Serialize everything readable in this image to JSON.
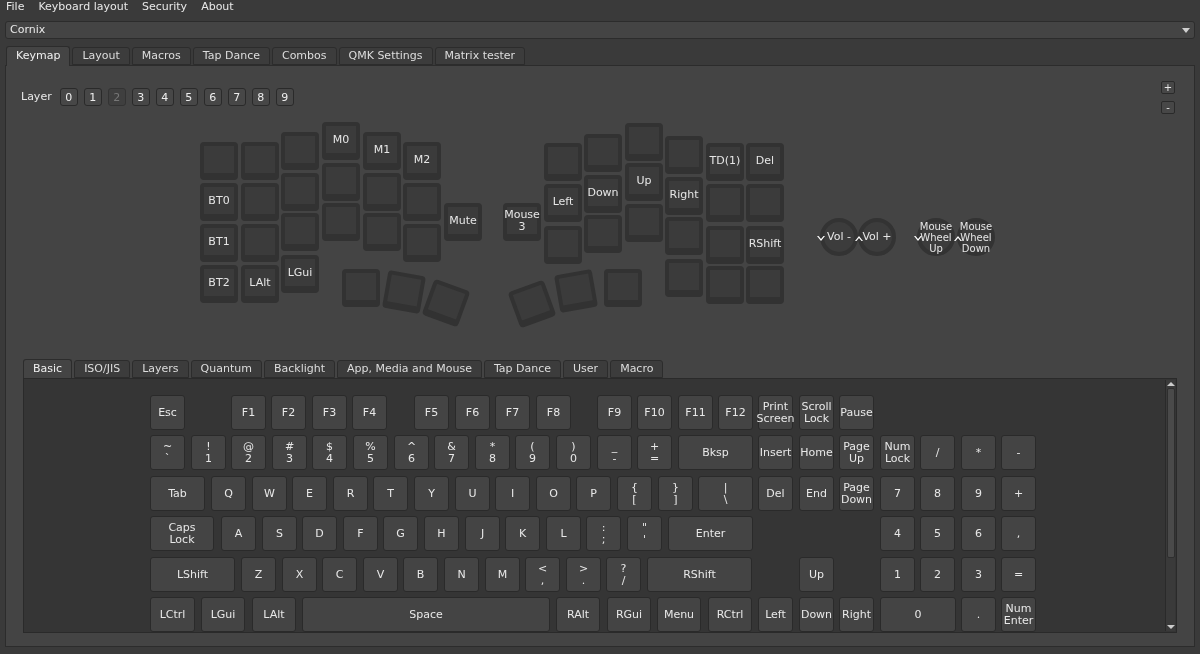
{
  "menu": [
    "File",
    "Keyboard layout",
    "Security",
    "About"
  ],
  "keyboard_select": {
    "value": "Cornix"
  },
  "tabs": [
    {
      "label": "Keymap",
      "selected": true
    },
    {
      "label": "Layout",
      "selected": false
    },
    {
      "label": "Macros",
      "selected": false
    },
    {
      "label": "Tap Dance",
      "selected": false
    },
    {
      "label": "Combos",
      "selected": false
    },
    {
      "label": "QMK Settings",
      "selected": false
    },
    {
      "label": "Matrix tester",
      "selected": false
    }
  ],
  "layers": {
    "label": "Layer",
    "buttons": [
      {
        "label": "0",
        "selected": false
      },
      {
        "label": "1",
        "selected": false
      },
      {
        "label": "2",
        "selected": true
      },
      {
        "label": "3",
        "selected": false
      },
      {
        "label": "4",
        "selected": false
      },
      {
        "label": "5",
        "selected": false
      },
      {
        "label": "6",
        "selected": false
      },
      {
        "label": "7",
        "selected": false
      },
      {
        "label": "8",
        "selected": false
      },
      {
        "label": "9",
        "selected": false
      }
    ]
  },
  "layer_controls": [
    "+",
    "-"
  ],
  "keymap": {
    "left": [
      {
        "kind": "blank"
      },
      {
        "kind": "labeled",
        "label": "BT0"
      },
      {
        "kind": "labeled",
        "label": "BT1"
      },
      {
        "kind": "labeled",
        "label": "BT2"
      },
      {
        "kind": "blank"
      },
      {
        "kind": "blank"
      },
      {
        "kind": "blank"
      },
      {
        "kind": "labeled",
        "label": "LAlt"
      },
      {
        "kind": "blank"
      },
      {
        "kind": "blank"
      },
      {
        "kind": "blank"
      },
      {
        "kind": "labeled",
        "label": "LGui"
      },
      {
        "kind": "labeled",
        "label": "M0"
      },
      {
        "kind": "blank"
      },
      {
        "kind": "blank"
      },
      {
        "kind": "labeled",
        "label": "M1"
      },
      {
        "kind": "blank"
      },
      {
        "kind": "blank"
      },
      {
        "kind": "labeled",
        "label": "M2"
      },
      {
        "kind": "blank"
      },
      {
        "kind": "blank"
      },
      {
        "kind": "labeled",
        "label": "Mute"
      },
      {
        "kind": "blank"
      },
      {
        "kind": "blank"
      },
      {
        "kind": "blank"
      }
    ],
    "right": [
      {
        "kind": "labeled",
        "label": "Mouse\n3"
      },
      {
        "kind": "blank"
      },
      {
        "kind": "labeled",
        "label": "Left"
      },
      {
        "kind": "blank"
      },
      {
        "kind": "blank"
      },
      {
        "kind": "labeled",
        "label": "Down"
      },
      {
        "kind": "blank"
      },
      {
        "kind": "blank"
      },
      {
        "kind": "labeled",
        "label": "Up"
      },
      {
        "kind": "blank"
      },
      {
        "kind": "blank"
      },
      {
        "kind": "labeled",
        "label": "Right"
      },
      {
        "kind": "blank"
      },
      {
        "kind": "blank"
      },
      {
        "kind": "labeled",
        "label": "TD(1)"
      },
      {
        "kind": "blank"
      },
      {
        "kind": "blank"
      },
      {
        "kind": "blank"
      },
      {
        "kind": "labeled",
        "label": "Del"
      },
      {
        "kind": "blank"
      },
      {
        "kind": "labeled",
        "label": "RShift"
      },
      {
        "kind": "blank"
      },
      {
        "kind": "blank"
      },
      {
        "kind": "blank"
      },
      {
        "kind": "blank"
      }
    ],
    "encoders": [
      {
        "kind": "down",
        "label": "Vol -"
      },
      {
        "kind": "up",
        "label": "Vol +"
      },
      {
        "kind": "down",
        "label": "Mouse\nWheel\nUp"
      },
      {
        "kind": "up",
        "label": "Mouse\nWheel\nDown"
      }
    ]
  },
  "keycode_tabs": [
    {
      "label": "Basic",
      "selected": true
    },
    {
      "label": "ISO/JIS",
      "selected": false
    },
    {
      "label": "Layers",
      "selected": false
    },
    {
      "label": "Quantum",
      "selected": false
    },
    {
      "label": "Backlight",
      "selected": false
    },
    {
      "label": "App, Media and Mouse",
      "selected": false
    },
    {
      "label": "Tap Dance",
      "selected": false
    },
    {
      "label": "User",
      "selected": false
    },
    {
      "label": "Macro",
      "selected": false
    }
  ],
  "keycode_rows": [
    [
      "Esc",
      "F1",
      "F2",
      "F3",
      "F4",
      "F5",
      "F6",
      "F7",
      "F8",
      "F9",
      "F10",
      "F11",
      "F12",
      "Print\nScreen",
      "Scroll\nLock",
      "Pause"
    ],
    [
      "~\n`",
      "!\n1",
      "@\n2",
      "#\n3",
      "$\n4",
      "%\n5",
      "^\n6",
      "&\n7",
      "*\n8",
      "(\n9",
      ")\n0",
      "_\n-",
      "+\n=",
      "Bksp",
      "Insert",
      "Home",
      "Page\nUp",
      "Num\nLock",
      "/",
      "*",
      "-"
    ],
    [
      "Tab",
      "Q",
      "W",
      "E",
      "R",
      "T",
      "Y",
      "U",
      "I",
      "O",
      "P",
      "{\n[",
      "}\n]",
      "|\n\\",
      "Del",
      "End",
      "Page\nDown",
      "7",
      "8",
      "9",
      "+"
    ],
    [
      "Caps\nLock",
      "A",
      "S",
      "D",
      "F",
      "G",
      "H",
      "J",
      "K",
      "L",
      ":\n;",
      "\"\n'",
      "Enter",
      "4",
      "5",
      "6",
      ","
    ],
    [
      "LShift",
      "Z",
      "X",
      "C",
      "V",
      "B",
      "N",
      "M",
      "<\n,",
      ">\n.",
      "?\n/",
      "RShift",
      "Up",
      "1",
      "2",
      "3",
      "="
    ],
    [
      "LCtrl",
      "LGui",
      "LAlt",
      "Space",
      "RAlt",
      "RGui",
      "Menu",
      "RCtrl",
      "Left",
      "Down",
      "Right",
      "0",
      ".",
      "Num\nEnter"
    ]
  ]
}
